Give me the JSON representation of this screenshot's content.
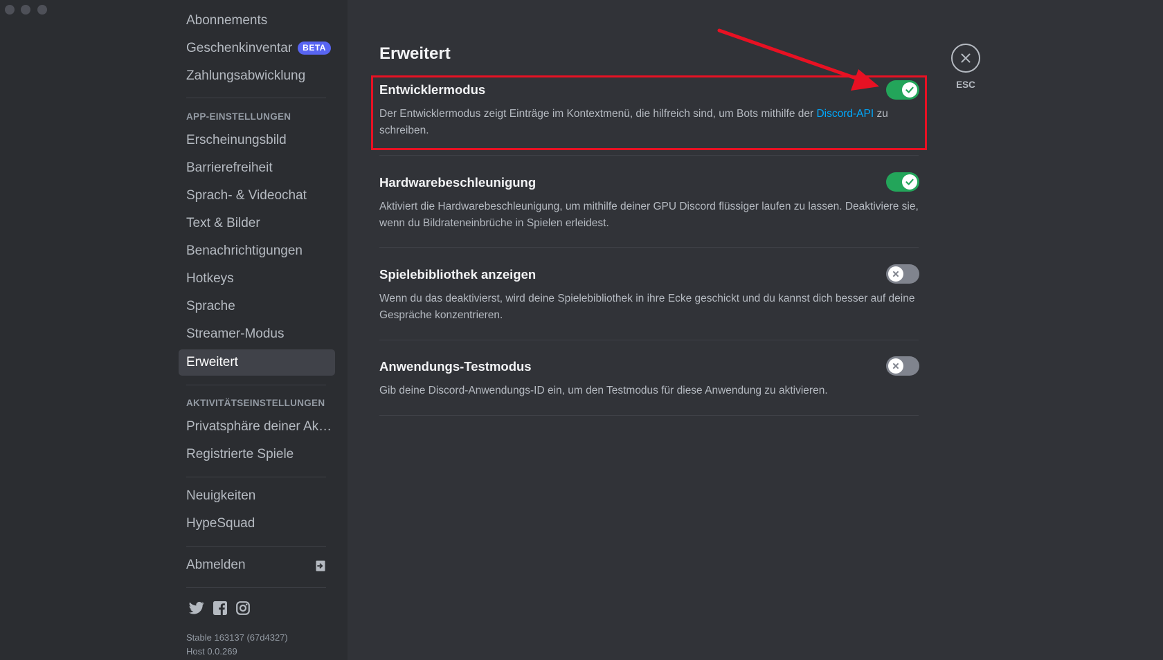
{
  "sidebar": {
    "items_top": [
      {
        "label": "Abonnements"
      },
      {
        "label": "Geschenkinventar",
        "badge": "BETA"
      },
      {
        "label": "Zahlungsabwicklung"
      }
    ],
    "app_section": {
      "header": "APP-EINSTELLUNGEN",
      "items": [
        {
          "label": "Erscheinungsbild"
        },
        {
          "label": "Barrierefreiheit"
        },
        {
          "label": "Sprach- & Videochat"
        },
        {
          "label": "Text & Bilder"
        },
        {
          "label": "Benachrichtigungen"
        },
        {
          "label": "Hotkeys"
        },
        {
          "label": "Sprache"
        },
        {
          "label": "Streamer-Modus"
        },
        {
          "label": "Erweitert",
          "active": true
        }
      ]
    },
    "activity_section": {
      "header": "AKTIVITÄTSEINSTELLUNGEN",
      "items": [
        {
          "label": "Privatsphäre deiner Aktivitäten"
        },
        {
          "label": "Registrierte Spiele"
        }
      ]
    },
    "items_misc": [
      {
        "label": "Neuigkeiten"
      },
      {
        "label": "HypeSquad"
      }
    ],
    "logout": {
      "label": "Abmelden",
      "icon": "logout-icon"
    },
    "social_icons": [
      "twitter-icon",
      "facebook-icon",
      "instagram-icon"
    ],
    "version": {
      "line1": "Stable 163137 (67d4327)",
      "line2": "Host 0.0.269"
    }
  },
  "main": {
    "title": "Erweitert",
    "settings": [
      {
        "title": "Entwicklermodus",
        "desc_before": "Der Entwicklermodus zeigt Einträge im Kontextmenü, die hilfreich sind, um Bots mithilfe der ",
        "desc_link": "Discord-API",
        "desc_after": " zu schreiben.",
        "enabled": true
      },
      {
        "title": "Hardwarebeschleunigung",
        "desc": "Aktiviert die Hardwarebeschleunigung, um mithilfe deiner GPU Discord flüssiger laufen zu lassen. Deaktiviere sie, wenn du Bildrateneinbrüche in Spielen erleidest.",
        "enabled": true
      },
      {
        "title": "Spielebibliothek anzeigen",
        "desc": "Wenn du das deaktivierst, wird deine Spielebibliothek in ihre Ecke geschickt und du kannst dich besser auf deine Gespräche konzentrieren.",
        "enabled": false
      },
      {
        "title": "Anwendungs-Testmodus",
        "desc": "Gib deine Discord-Anwendungs-ID ein, um den Testmodus für diese Anwendung zu aktivieren.",
        "enabled": false
      }
    ]
  },
  "close": {
    "label": "ESC"
  },
  "colors": {
    "toggle_on": "#23a55a",
    "toggle_off": "#80848e",
    "link": "#00a8fc",
    "highlight": "#e81123",
    "beta_badge": "#5865f2"
  }
}
